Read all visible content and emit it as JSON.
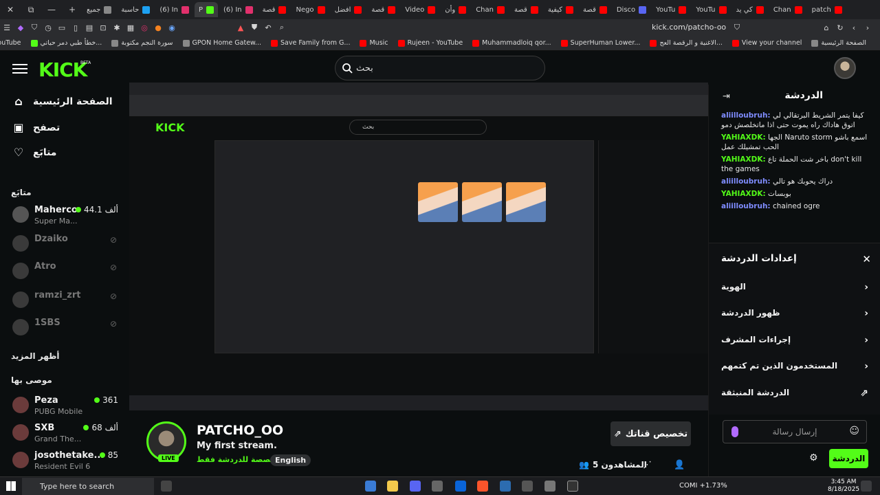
{
  "browser": {
    "tabs": [
      {
        "label": "جميع",
        "color": "#888"
      },
      {
        "label": "حاسبة",
        "color": "#1da1f2"
      },
      {
        "label": "(6) In",
        "color": "#e1306c"
      },
      {
        "label": "P",
        "color": "#53fc18",
        "active": true
      },
      {
        "label": "(6) In",
        "color": "#e1306c"
      },
      {
        "label": "قصة",
        "color": "#ff0000"
      },
      {
        "label": "Nego",
        "color": "#ff0000"
      },
      {
        "label": "افضل",
        "color": "#ff0000"
      },
      {
        "label": "قصة",
        "color": "#ff0000"
      },
      {
        "label": "Video",
        "color": "#ff0000"
      },
      {
        "label": "وأن",
        "color": "#ff0000"
      },
      {
        "label": "Chan",
        "color": "#ff0000"
      },
      {
        "label": "قصة",
        "color": "#ff0000"
      },
      {
        "label": "كيفية",
        "color": "#ff0000"
      },
      {
        "label": "قصة",
        "color": "#ff0000"
      },
      {
        "label": "Disco",
        "color": "#5865f2"
      },
      {
        "label": "YouTu",
        "color": "#ff0000"
      },
      {
        "label": "YouTu",
        "color": "#ff0000"
      },
      {
        "label": "كي يد",
        "color": "#ff0000"
      },
      {
        "label": "Chan",
        "color": "#ff0000"
      },
      {
        "label": "patch",
        "color": "#ff0000"
      }
    ],
    "url": "kick.com/patcho-oo",
    "bookmarks": [
      {
        "label": "YouTube",
        "color": "#ff0000"
      },
      {
        "label": "خطأ طبي دمر حياتي...",
        "color": "#53fc18"
      },
      {
        "label": "سورة النجم مكتوبة",
        "color": "#888"
      },
      {
        "label": "GPON Home Gatew...",
        "color": "#888"
      },
      {
        "label": "Save Family from G...",
        "color": "#ff0000"
      },
      {
        "label": "Music",
        "color": "#ff0000"
      },
      {
        "label": "Rujeen - YouTube",
        "color": "#ff0000"
      },
      {
        "label": "Muhammadloiq qor...",
        "color": "#ff0000"
      },
      {
        "label": "SuperHuman Lower...",
        "color": "#ff0000"
      },
      {
        "label": "الاغنية و الرقصة العج...",
        "color": "#ff0000"
      },
      {
        "label": "View your channel",
        "color": "#ff0000"
      },
      {
        "label": "الصفحة الرئيسية",
        "color": "#888"
      }
    ]
  },
  "kick": {
    "logo": "KICK",
    "beta": "BETA",
    "search_placeholder": "بحث",
    "nav": {
      "home": "الصفحة الرئيسية",
      "browse": "تصفح",
      "following": "متابَع"
    },
    "following_title": "متابَع",
    "following": [
      {
        "name": "Maherco",
        "sub": "Super Ma...",
        "viewers": "44.1 ألف",
        "live": true
      },
      {
        "name": "Dzaiko",
        "live": false
      },
      {
        "name": "Atro",
        "live": false
      },
      {
        "name": "ramzi_zrt",
        "live": false
      },
      {
        "name": "1SBS",
        "live": false
      }
    ],
    "show_more": "أظهر المزيد",
    "recommended_title": "موصى بها",
    "recommended": [
      {
        "name": "Peza",
        "sub": "PUBG Mobile",
        "viewers": "361"
      },
      {
        "name": "SXB",
        "sub": "Grand The...",
        "viewers": "68 ألف"
      },
      {
        "name": "josothetake...",
        "sub": "Resident Evil 6",
        "viewers": "85"
      }
    ]
  },
  "stream": {
    "streamer": "PATCHO_OO",
    "live": "LIVE",
    "title": "My first stream.",
    "chat_only": "مخصصة للدردشة فقط",
    "language": "English",
    "customize": "تخصيص قناتك",
    "viewers": "المشاهدون 5"
  },
  "chat": {
    "title": "الدردشة",
    "messages": [
      {
        "user": "aliilloubruh:",
        "text": "كيفا يتمر الشريط البرتقالي لي اتوق هاداك راه يموت حتى اذا ماتخلصش دمو",
        "color": "u1"
      },
      {
        "user": "YAHIAXDK:",
        "text": "الجها Naruto storm اسمع باشو الحب تمشيلك عمل",
        "color": "u2"
      },
      {
        "user": "YAHIAXDK:",
        "text": "باخر شت الحملة تاع don't kill the games",
        "color": "u2"
      },
      {
        "user": "aliilloubruh:",
        "text": "دراك يحوبك هو تالي",
        "color": "u1"
      },
      {
        "user": "YAHIAXDK:",
        "text": "بوبسات",
        "color": "u2"
      },
      {
        "user": "aliilloubruh:",
        "text": "chained ogre",
        "color": "u1"
      }
    ],
    "settings_title": "إعدادات الدردشة",
    "settings": [
      "الهوية",
      "ظهور الدردشة",
      "إجراءات المشرف",
      "المستخدمون الذين تم كتمهم",
      "الدردشة المنبثقة"
    ],
    "input_placeholder": "إرسال رسالة",
    "send": "الدردشة"
  },
  "taskbar": {
    "search": "Type here to search",
    "market": "COMI +1.73%",
    "time": "3:45 AM",
    "date": "8/18/2025"
  }
}
